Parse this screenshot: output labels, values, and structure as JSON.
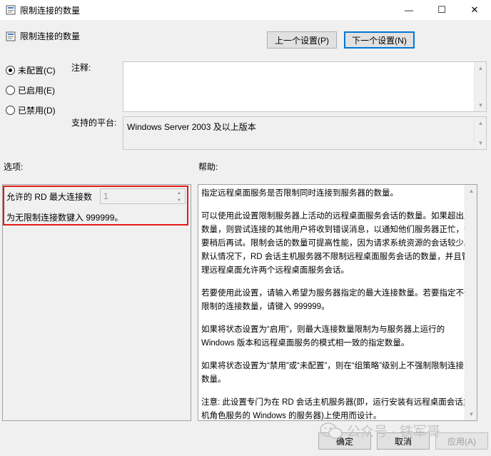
{
  "window": {
    "title": "限制连接的数量",
    "minimize_glyph": "—",
    "maximize_glyph": "☐",
    "close_glyph": "✕"
  },
  "header": {
    "title": "限制连接的数量"
  },
  "nav": {
    "prev_label": "上一个设置(P)",
    "next_label": "下一个设置(N)"
  },
  "state": {
    "options": [
      {
        "label": "未配置(C)",
        "checked": true
      },
      {
        "label": "已启用(E)",
        "checked": false
      },
      {
        "label": "已禁用(D)",
        "checked": false
      }
    ]
  },
  "comment": {
    "label": "注释:",
    "value": ""
  },
  "platform": {
    "label": "支持的平台:",
    "value": "Windows Server 2003 及以上版本"
  },
  "options_section": {
    "label": "选项:",
    "max_conn_label": "允许的 RD 最大连接数",
    "max_conn_value": "1",
    "hint": "为无限制连接数键入 999999。"
  },
  "help_section": {
    "label": "帮助:",
    "paragraphs": [
      "指定远程桌面服务是否限制同时连接到服务器的数量。",
      "可以使用此设置限制服务器上活动的远程桌面服务会话的数量。如果超出此数量，则尝试连接的其他用户将收到错误消息，以通知他们服务器正忙，需要稍后再试。限制会话的数量可提高性能，因为请求系统资源的会话较少。默认情况下，RD 会话主机服务器不限制远程桌面服务会话的数量，并且管理远程桌面允许两个远程桌面服务会话。",
      "若要使用此设置，请输入希望为服务器指定的最大连接数量。若要指定不受限制的连接数量，请键入 999999。",
      "如果将状态设置为“启用”，则最大连接数量限制为与服务器上运行的 Windows 版本和远程桌面服务的模式相一致的指定数量。",
      "如果将状态设置为“禁用”或“未配置”，则在“组策略”级别上不强制限制连接的数量。",
      "注意: 此设置专门为在 RD 会话主机服务器(即，运行安装有远程桌面会话主机角色服务的 Windows 的服务器)上使用而设计。"
    ]
  },
  "footer": {
    "ok_label": "确定",
    "cancel_label": "取消",
    "apply_label": "应用(A)"
  },
  "watermark": {
    "text": "公众号 · 铁军哥"
  },
  "colors": {
    "highlight": "#e21b1b",
    "primary_border": "#0078d7"
  }
}
